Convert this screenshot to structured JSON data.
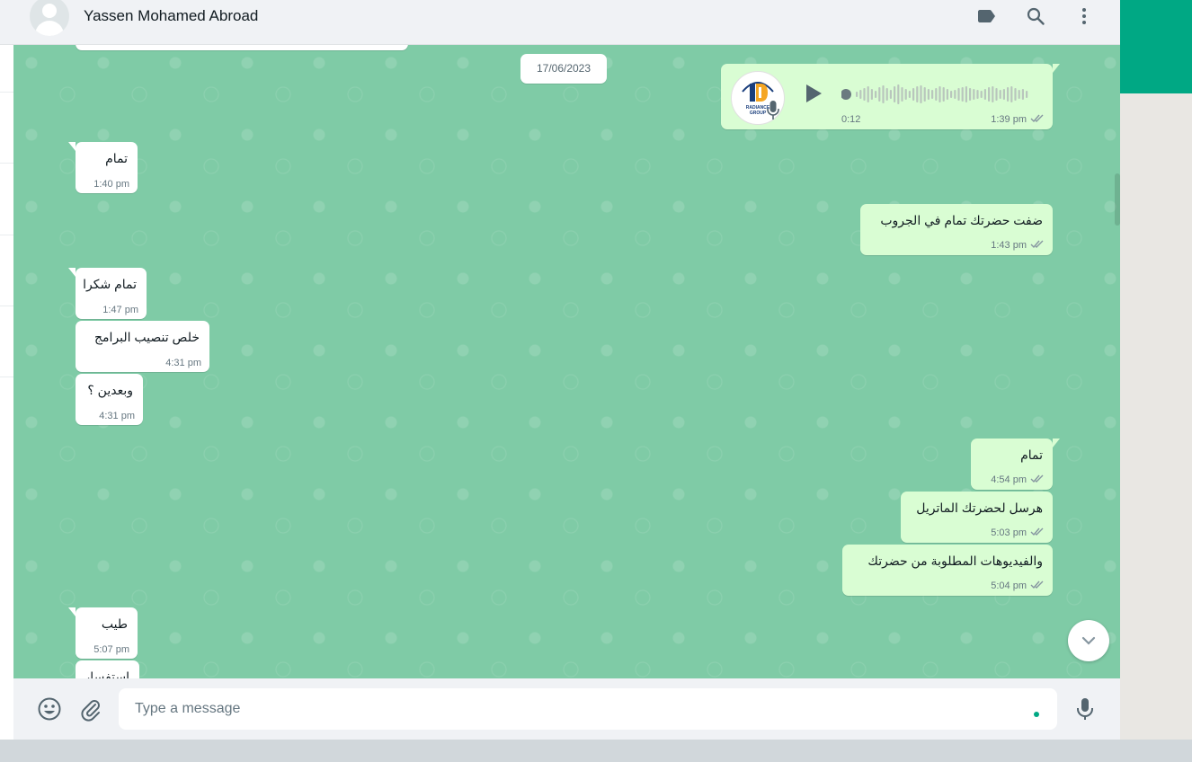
{
  "header": {
    "contact_name": "Yassen Mohamed Abroad",
    "icons": [
      "label-icon",
      "search-icon",
      "menu-icon"
    ]
  },
  "chat": {
    "date_divider": "17/06/2023",
    "voice_message": {
      "duration": "0:12",
      "time": "1:39 pm",
      "avatar_label": "RADIANCE GROUP",
      "status": "read"
    },
    "messages": [
      {
        "dir": "in",
        "text": "تمام",
        "time": "1:40 pm"
      },
      {
        "dir": "out",
        "text": "ضفت حضرتك تمام في الجروب",
        "time": "1:43 pm"
      },
      {
        "dir": "in",
        "text": "تمام شكرا",
        "time": "1:47 pm"
      },
      {
        "dir": "in",
        "text": "خلص تنصيب البرامج",
        "time": "4:31 pm"
      },
      {
        "dir": "in",
        "text": "وبعدين ؟",
        "time": "4:31 pm"
      },
      {
        "dir": "out",
        "text": "تمام",
        "time": "4:54 pm"
      },
      {
        "dir": "out",
        "text": "هرسل لحضرتك الماتريل",
        "time": "5:03 pm"
      },
      {
        "dir": "out",
        "text": "والفيديوهات المطلوبة من حضرتك",
        "time": "5:04 pm"
      },
      {
        "dir": "in",
        "text": "طيب",
        "time": "5:07 pm"
      },
      {
        "dir": "in",
        "text": "استفسار",
        "time": ""
      }
    ]
  },
  "composer": {
    "placeholder": "Type a message"
  },
  "colors": {
    "chat_background": "#7fcba6",
    "incoming_bubble": "#ffffff",
    "outgoing_bubble": "#d9fdd3",
    "accent": "#00a884"
  }
}
